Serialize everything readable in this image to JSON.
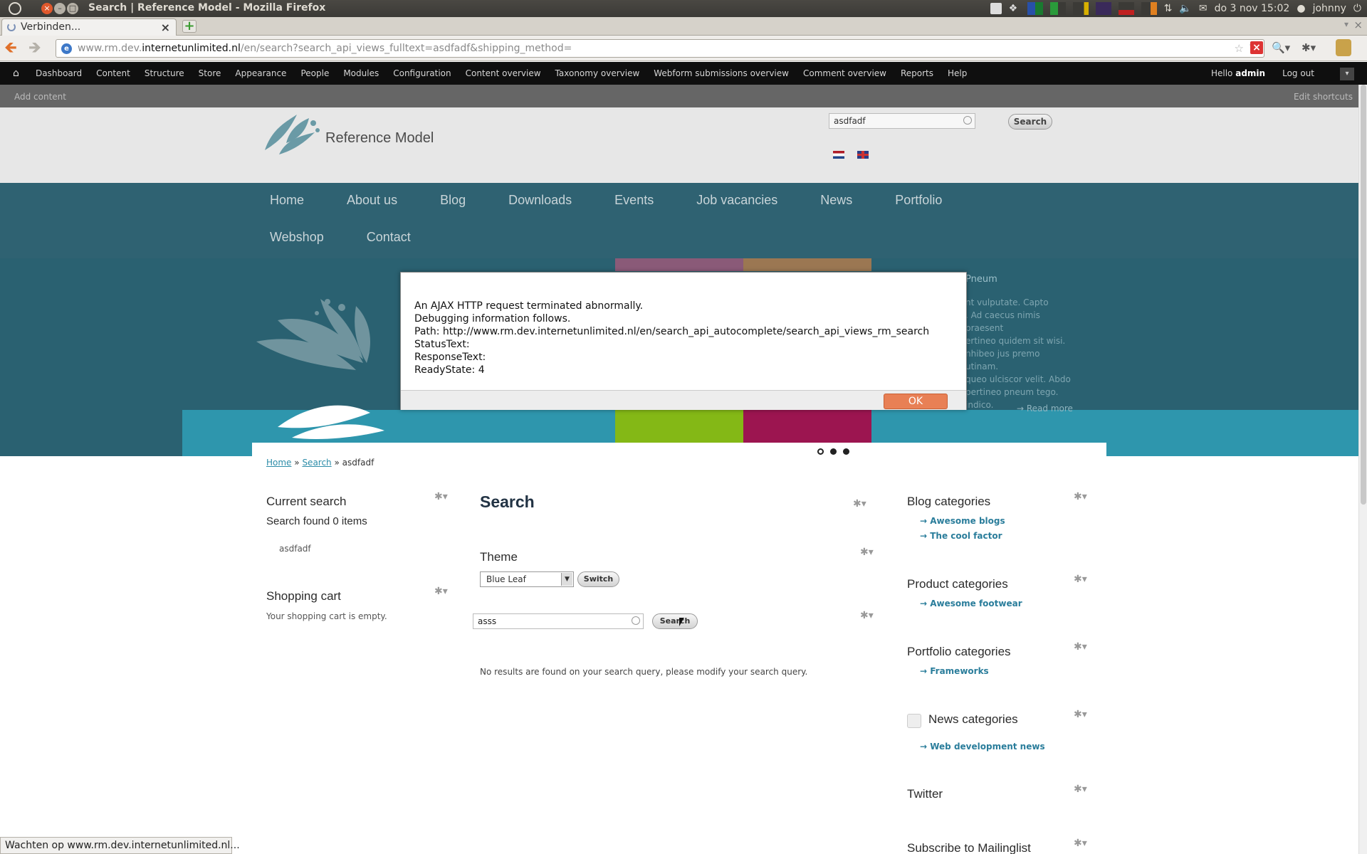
{
  "os": {
    "window_title": "Search | Reference Model - Mozilla Firefox",
    "clock": "do 3 nov 15:02",
    "user": "johnny"
  },
  "browser": {
    "tab_title": "Verbinden...",
    "url_prefix": "www.rm.dev.",
    "url_domain": "internetunlimited.nl",
    "url_path": "/en/search?search_api_views_fulltext=asdfadf&shipping_method=",
    "status": "Wachten op www.rm.dev.internetunlimited.nl..."
  },
  "admin_toolbar": {
    "items": [
      "Dashboard",
      "Content",
      "Structure",
      "Store",
      "Appearance",
      "People",
      "Modules",
      "Configuration",
      "Content overview",
      "Taxonomy overview",
      "Webform submissions overview",
      "Comment overview",
      "Reports",
      "Help"
    ],
    "hello": "Hello",
    "username": "admin",
    "logout": "Log out",
    "add_content": "Add content",
    "edit_shortcuts": "Edit shortcuts"
  },
  "header": {
    "site_name": "Reference Model",
    "search_value": "asdfadf",
    "search_button": "Search"
  },
  "main_nav": {
    "items": [
      "Home",
      "About us",
      "Blog",
      "Downloads",
      "Events",
      "Job vacancies",
      "News",
      "Portfolio",
      "Webshop",
      "Contact"
    ]
  },
  "banner": {
    "heading_fragment": "Pneum",
    "text_lines": [
      "nt vulputate. Capto",
      ". Ad caecus nimis praesent",
      "ertineo quidem sit wisi.",
      "nhibeo jus premo utinam.",
      "queo ulciscor velit. Abdo",
      "pertineo pneum tego.",
      "indico."
    ],
    "read_more": "Read more"
  },
  "alert": {
    "lines": [
      "An AJAX HTTP request terminated abnormally.",
      "Debugging information follows.",
      "Path: http://www.rm.dev.internetunlimited.nl/en/search_api_autocomplete/search_api_views_rm_search",
      "StatusText:",
      "ResponseText:",
      "ReadyState: 4"
    ],
    "ok_label": "OK"
  },
  "breadcrumb": {
    "home": "Home",
    "search": "Search",
    "current": "asdfadf",
    "separator": "»"
  },
  "left_sidebar": {
    "current_search_title": "Current search",
    "found_text": "Search found 0 items",
    "query_value": "asdfadf",
    "cart_title": "Shopping cart",
    "cart_empty": "Your shopping cart is empty."
  },
  "main": {
    "title": "Search",
    "theme_title": "Theme",
    "theme_selected": "Blue Leaf",
    "switch_button": "Switch",
    "search_value": "asss",
    "search_button": "Search",
    "no_results": "No results are found on your search query, please modify your search query."
  },
  "right_sidebar": {
    "blog_title": "Blog categories",
    "blog_links": [
      "Awesome blogs",
      "The cool factor"
    ],
    "product_title": "Product categories",
    "product_links": [
      "Awesome footwear"
    ],
    "portfolio_title": "Portfolio categories",
    "portfolio_links": [
      "Frameworks"
    ],
    "news_title": "News categories",
    "news_links": [
      "Web development news"
    ],
    "twitter_title": "Twitter",
    "mailing_title": "Subscribe to Mailinglist"
  }
}
